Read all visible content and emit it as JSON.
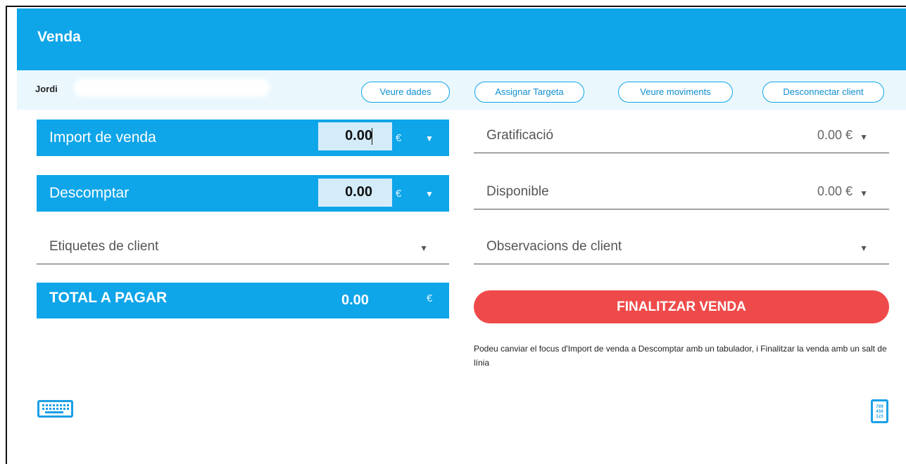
{
  "header": {
    "title": "Venda"
  },
  "client": {
    "name": "Jordi",
    "buttons": {
      "view_data": "Veure dades",
      "assign_card": "Assignar Targeta",
      "view_movements": "Veure moviments",
      "disconnect": "Desconnectar client"
    }
  },
  "sale": {
    "import_label": "Import de venda",
    "import_value": "0.00",
    "discount_label": "Descomptar",
    "discount_value": "0.00",
    "currency": "€",
    "tags_label": "Etiquetes de client",
    "total_label": "TOTAL A PAGAR",
    "total_value": "0.00"
  },
  "balances": {
    "gratification_label": "Gratificació",
    "gratification_value": "0.00 €",
    "available_label": "Disponible",
    "available_value": "0.00 €",
    "observations_label": "Observacions de client"
  },
  "actions": {
    "finish_label": "FINALITZAR VENDA",
    "hint": "Podeu canviar el focus d'Import de venda a Descomptar amb un tabulador, i Finalitzar la venda amb un salt de línia"
  },
  "icons": {
    "dropdown": "▼",
    "numpad_digits": [
      "789",
      "456",
      "123"
    ]
  },
  "colors": {
    "primary": "#0ea5e9",
    "light_bg": "#eaf8fe",
    "danger": "#ef4a4a"
  }
}
